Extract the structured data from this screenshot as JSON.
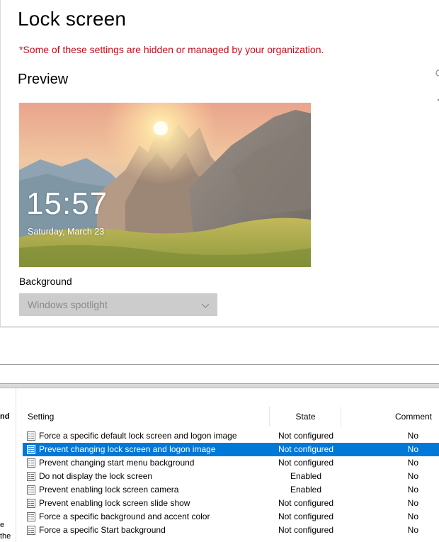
{
  "settings": {
    "title": "Lock screen",
    "managed_note": "*Some of these settings are hidden or managed by your organization.",
    "preview_heading": "Preview",
    "lock_time": "15:57",
    "lock_date": "Saturday, March 23",
    "background_label": "Background",
    "background_value": "Windows spotlight"
  },
  "gpe": {
    "left_pane": {
      "top_text": "nd",
      "bottom_line1": "e",
      "bottom_line2": "the"
    },
    "columns": {
      "setting": "Setting",
      "state": "State",
      "comment": "Comment"
    },
    "rows": [
      {
        "name": "Force a specific default lock screen and logon image",
        "state": "Not configured",
        "comment": "No",
        "selected": false
      },
      {
        "name": "Prevent changing lock screen and logon image",
        "state": "Not configured",
        "comment": "No",
        "selected": true
      },
      {
        "name": "Prevent changing start menu background",
        "state": "Not configured",
        "comment": "No",
        "selected": false
      },
      {
        "name": "Do not display the lock screen",
        "state": "Enabled",
        "comment": "No",
        "selected": false
      },
      {
        "name": "Prevent enabling lock screen camera",
        "state": "Enabled",
        "comment": "No",
        "selected": false
      },
      {
        "name": "Prevent enabling lock screen slide show",
        "state": "Not configured",
        "comment": "No",
        "selected": false
      },
      {
        "name": "Force a specific background and accent color",
        "state": "Not configured",
        "comment": "No",
        "selected": false
      },
      {
        "name": "Force a specific Start background",
        "state": "Not configured",
        "comment": "No",
        "selected": false
      }
    ]
  },
  "colors": {
    "accent": "#0078d7",
    "managed_note": "#c50f1f",
    "dropdown_bg": "#cccccc"
  },
  "icons": {
    "policy": "policy-setting-icon",
    "chevron": "chevron-down-icon"
  }
}
